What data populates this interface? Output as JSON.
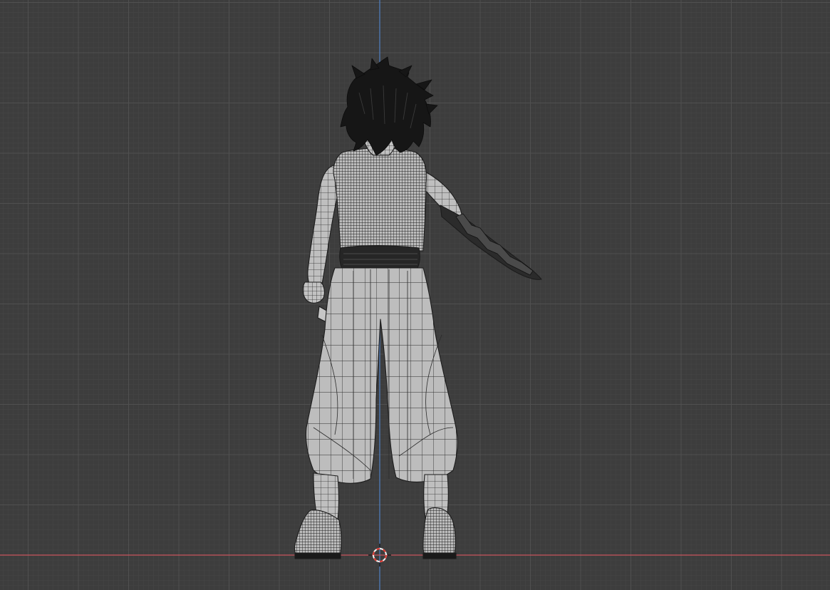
{
  "viewport": {
    "view": "back-orthographic",
    "shading": "wireframe-overlay-solid",
    "grid": true,
    "colors": {
      "background": "#3d3d3d",
      "grid_minor": "#474747",
      "grid_major": "#505050",
      "axis_x": "#c9545d",
      "axis_z": "#4f7bb8",
      "mesh_fill": "#b8b8b8",
      "mesh_wire": "#1c1c1c",
      "hair": "#151515",
      "cursor_red": "#e0382f",
      "cursor_white": "#f2f2f2"
    }
  },
  "scene": {
    "object": "character-mesh",
    "pose": "standing-back-view-holding-blade",
    "icons": {
      "origin": "3d-cursor-icon"
    }
  }
}
